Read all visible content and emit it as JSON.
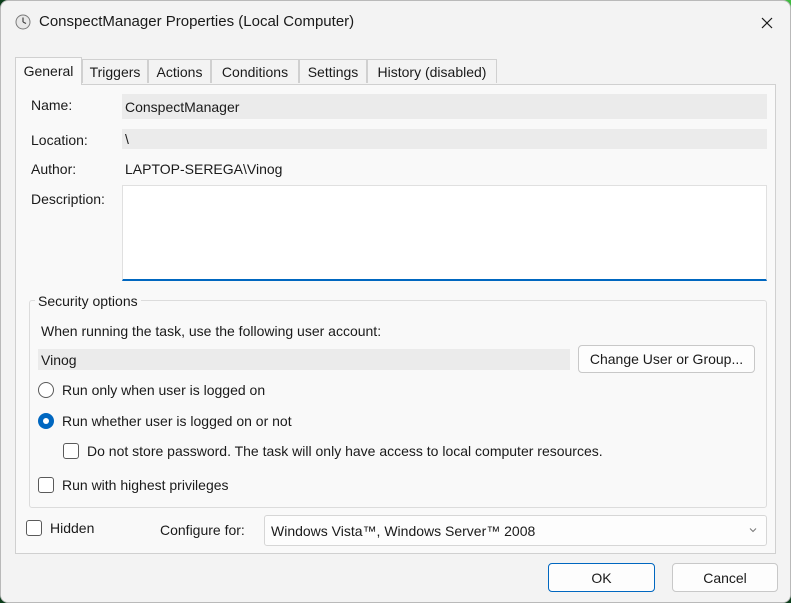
{
  "window": {
    "title": "ConspectManager Properties (Local Computer)",
    "icon": "task-scheduler-clock-icon"
  },
  "tabs": [
    {
      "label": "General",
      "active": true
    },
    {
      "label": "Triggers",
      "active": false
    },
    {
      "label": "Actions",
      "active": false
    },
    {
      "label": "Conditions",
      "active": false
    },
    {
      "label": "Settings",
      "active": false
    },
    {
      "label": "History (disabled)",
      "active": false
    }
  ],
  "general": {
    "name_label": "Name:",
    "name_value": "ConspectManager",
    "location_label": "Location:",
    "location_value": "\\",
    "author_label": "Author:",
    "author_value": "LAPTOP-SEREGA\\Vinog",
    "description_label": "Description:",
    "description_value": ""
  },
  "security": {
    "title": "Security options",
    "account_prompt": "When running the task, use the following user account:",
    "account_value": "Vinog",
    "change_user_button": "Change User or Group...",
    "radio_logged_on": "Run only when user is logged on",
    "radio_logged_on_checked": false,
    "radio_whether": "Run whether user is logged on or not",
    "radio_whether_checked": true,
    "no_store_password": "Do not store password.  The task will only have access to local computer resources.",
    "no_store_password_checked": false,
    "highest_privileges": "Run with highest privileges",
    "highest_privileges_checked": false
  },
  "bottom": {
    "hidden_label": "Hidden",
    "hidden_checked": false,
    "configure_label": "Configure for:",
    "configure_value": "Windows Vista™, Windows Server™ 2008"
  },
  "footer": {
    "ok_label": "OK",
    "cancel_label": "Cancel"
  },
  "colors": {
    "accent": "#0067c0",
    "background": "#f3f3f3",
    "panel": "#f9f9f9"
  }
}
